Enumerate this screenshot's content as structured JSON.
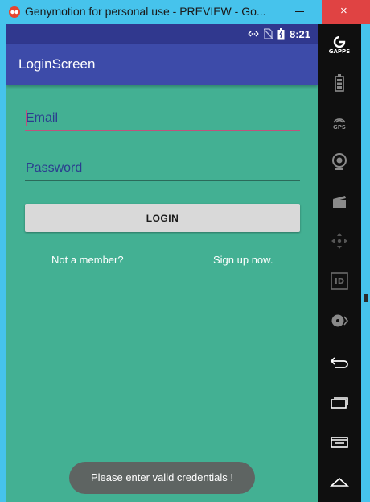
{
  "window": {
    "title": "Genymotion for personal use - PREVIEW - Go...",
    "close_glyph": "×"
  },
  "status_bar": {
    "time": "8:21",
    "icons": [
      "data-transfer-icon",
      "no-sim-icon",
      "battery-icon"
    ]
  },
  "app_bar": {
    "title": "LoginScreen"
  },
  "form": {
    "email_placeholder": "Email",
    "email_value": "",
    "password_placeholder": "Password",
    "password_value": "",
    "login_label": "LOGIN",
    "not_member_text": "Not a member?",
    "signup_text": "Sign up now."
  },
  "toast": {
    "message": "Please enter valid credentials !"
  },
  "sidebar_toolbar": {
    "gapps_label": "GAPPS",
    "gps_label": "GPS",
    "id_label": "ID",
    "items": [
      "gapps-icon",
      "battery-icon",
      "gps-icon",
      "webcam-icon",
      "clapper-icon",
      "dpad-icon",
      "id-icon",
      "disk-icon",
      "back-icon",
      "recent-apps-icon",
      "menu-icon",
      "home-icon"
    ]
  },
  "colors": {
    "title_bar": "#46c3ec",
    "close_button": "#e04343",
    "status_bar": "#30388e",
    "app_bar": "#3d4ba9",
    "screen_background": "#43b093",
    "accent": "#c0527d",
    "toast": "#5e6462",
    "toolbar": "#0f0f0f"
  }
}
